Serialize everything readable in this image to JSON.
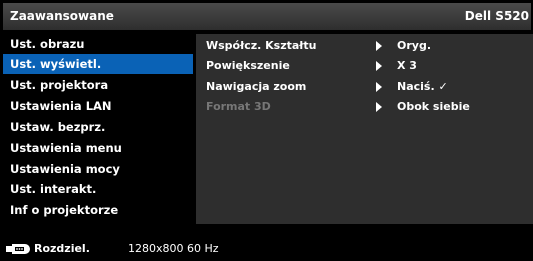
{
  "header": {
    "title": "Zaawansowane",
    "model": "Dell S520"
  },
  "sidebar": {
    "items": [
      {
        "label": "Ust. obrazu"
      },
      {
        "label": "Ust. wyświetl."
      },
      {
        "label": "Ust. projektora"
      },
      {
        "label": "Ustawienia LAN"
      },
      {
        "label": "Ustaw. bezprz."
      },
      {
        "label": "Ustawienia menu"
      },
      {
        "label": "Ustawienia mocy"
      },
      {
        "label": "Ust. interakt."
      },
      {
        "label": "Inf o projektorze"
      }
    ],
    "active_index": 1
  },
  "settings": {
    "rows": [
      {
        "label": "Współcz. Kształtu",
        "value": "Oryg.",
        "enabled": true
      },
      {
        "label": "Powiększenie",
        "value": "X 3",
        "enabled": true
      },
      {
        "label": "Nawigacja zoom",
        "value": "Naciś.  ✓",
        "enabled": true
      },
      {
        "label": "Format 3D",
        "value": "Obok siebie",
        "enabled": false
      }
    ]
  },
  "footer": {
    "resolution_label": "Rozdziel.",
    "resolution_value": "1280x800 60 Hz",
    "icon": "video-input-icon"
  },
  "colors": {
    "highlight": "#0a62b6",
    "panel": "#2e2e2e",
    "disabled_text": "#777777"
  }
}
